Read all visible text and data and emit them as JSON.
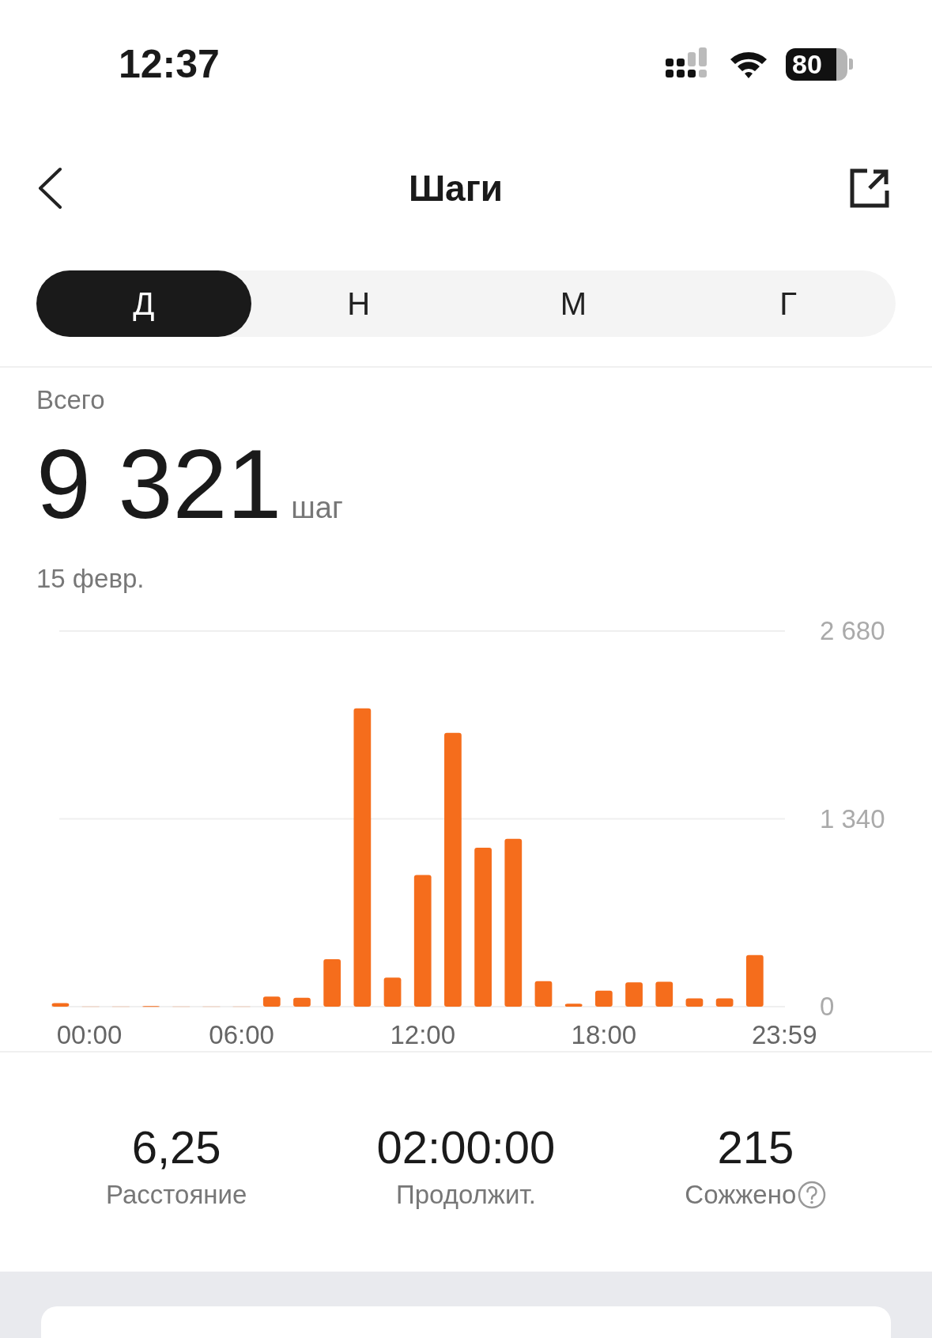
{
  "status_bar": {
    "time": "12:37",
    "battery": "80"
  },
  "header": {
    "title": "Шаги"
  },
  "tabs": [
    {
      "label": "Д",
      "selected": true
    },
    {
      "label": "Н",
      "selected": false
    },
    {
      "label": "М",
      "selected": false
    },
    {
      "label": "Г",
      "selected": false
    }
  ],
  "summary": {
    "label": "Всего",
    "value": "9 321",
    "unit": "шаг",
    "date": "15 февр."
  },
  "chart_data": {
    "type": "bar",
    "x": [
      0,
      1,
      2,
      3,
      4,
      5,
      6,
      7,
      8,
      9,
      10,
      11,
      12,
      13,
      14,
      15,
      16,
      17,
      18,
      19,
      20,
      21,
      22,
      23
    ],
    "series": [
      {
        "color": "#f56d1c",
        "values": [
          25,
          0,
          0,
          4,
          0,
          0,
          0,
          72,
          63,
          338,
          2128,
          207,
          939,
          1954,
          1134,
          1197,
          182,
          21,
          114,
          173,
          178,
          59,
          59,
          368
        ]
      }
    ],
    "xlim": [
      -0.3,
      24
    ],
    "ylim": [
      0,
      2680
    ],
    "xticks": [
      {
        "value": 0,
        "label": "00:00"
      },
      {
        "value": 6,
        "label": "06:00"
      },
      {
        "value": 12,
        "label": "12:00"
      },
      {
        "value": 18,
        "label": "18:00"
      },
      {
        "value": 23.98,
        "label": "23:59"
      }
    ],
    "yticks": [
      {
        "value": 0,
        "label": "0"
      },
      {
        "value": 1340,
        "label": "1 340"
      },
      {
        "value": 2680,
        "label": "2 680"
      }
    ]
  },
  "stats": [
    {
      "value": "6,25",
      "label": "Расстояние",
      "info": false
    },
    {
      "value": "02:00:00",
      "label": "Продолжит.",
      "info": false
    },
    {
      "value": "215",
      "label": "Сожжено",
      "info": true
    }
  ]
}
